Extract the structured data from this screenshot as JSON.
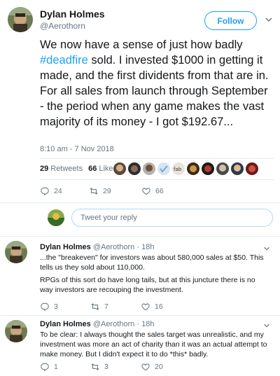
{
  "tweet": {
    "author_name": "Dylan Holmes",
    "author_handle": "@Aerothorn",
    "follow_label": "Follow",
    "text_before": "We now have a sense of just how badly ",
    "hashtag": "#deadfire",
    "text_after": " sold. I invested $1000 in getting it made, and the first dividents from that are in. For all sales from launch through September - the period when any game makes the vast majority of its money - I got $192.67...",
    "timestamp": "8:10 am - 7 Nov 2018",
    "retweets_count": "29",
    "retweets_label": "Retweets",
    "likes_count": "66",
    "likes_label": "Likes",
    "actions": {
      "replies": "24",
      "retweets": "29",
      "likes": "66"
    }
  },
  "reply_box": {
    "placeholder": "Tweet your reply"
  },
  "replies": [
    {
      "author_name": "Dylan Holmes",
      "author_handle": "@Aerothorn",
      "age": "· 18h",
      "paragraph1": "...the \"breakeven\" for investors was about 580,000 sales at $50. This tells us they sold about 110,000.",
      "paragraph2": "RPGs of this sort do have long tails, but at this juncture there is no way investors are recouping the investment.",
      "actions": {
        "replies": "3",
        "retweets": "7",
        "likes": "16"
      }
    },
    {
      "author_name": "Dylan Holmes",
      "author_handle": "@Aerothorn",
      "age": "· 18h",
      "paragraph1": "To be clear: I always thought the sales target was unrealistic, and my investment was more an act of charity than it was an actual attempt to make money. But I didn't expect it to do *this* badly.",
      "actions": {
        "replies": "1",
        "retweets": "3",
        "likes": "20"
      }
    }
  ],
  "colors": {
    "accent": "#1da1f2",
    "text": "#14171a",
    "muted": "#657786",
    "retweet_green": "#17bf63",
    "like_red": "#e0245e"
  },
  "icons": [
    "chevron-down-icon",
    "reply-icon",
    "retweet-icon",
    "like-icon",
    "message-icon"
  ]
}
